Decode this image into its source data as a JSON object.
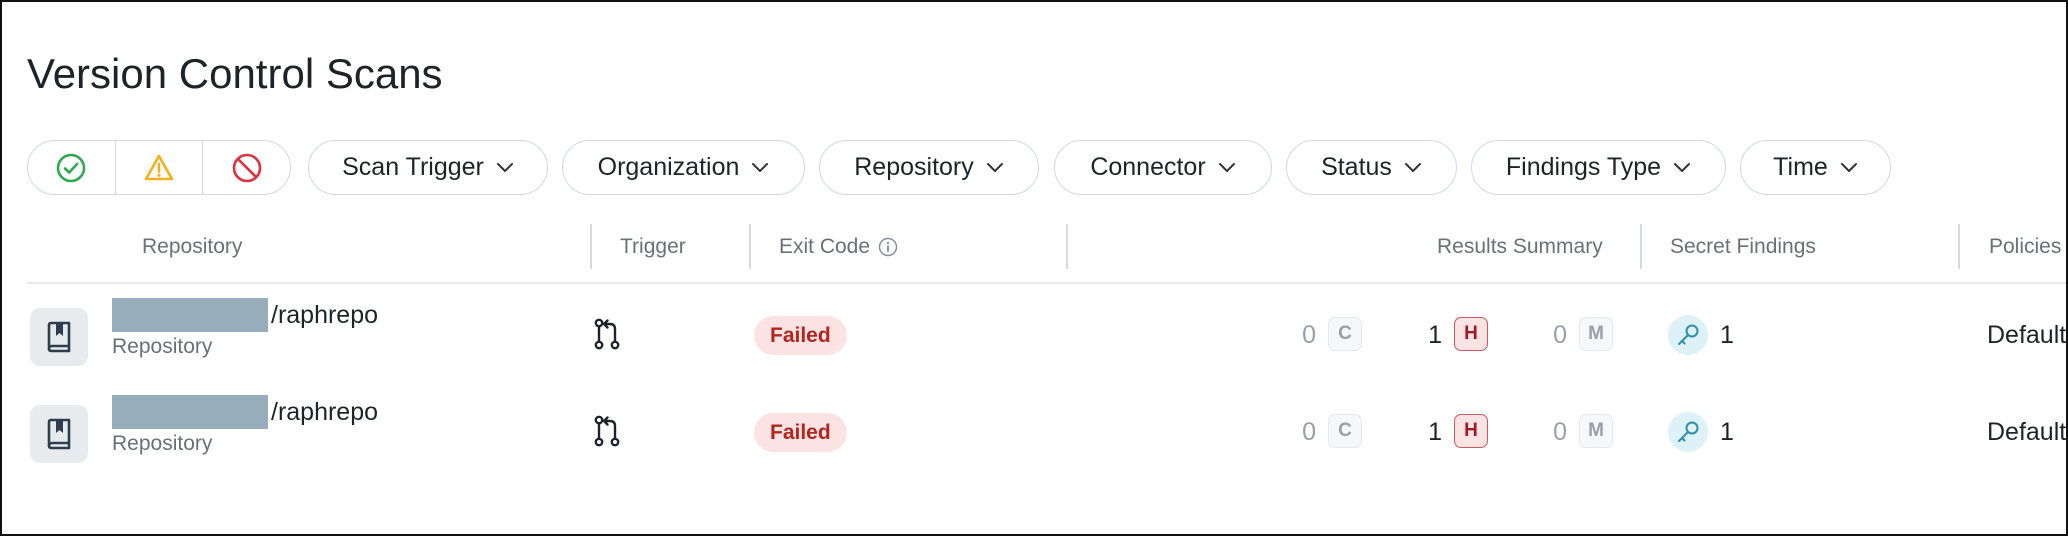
{
  "page": {
    "title": "Version Control Scans"
  },
  "status_filter": {
    "buttons": [
      {
        "name": "passed",
        "icon": "check-circle-icon",
        "color": "#2fa84f"
      },
      {
        "name": "warning",
        "icon": "warning-triangle-icon",
        "color": "#f2b01e"
      },
      {
        "name": "failed",
        "icon": "prohibited-icon",
        "color": "#d9333f"
      }
    ]
  },
  "filters": {
    "scan_trigger": "Scan Trigger",
    "organization": "Organization",
    "repository": "Repository",
    "connector": "Connector",
    "status": "Status",
    "findings_type": "Findings Type",
    "time": "Time",
    "dropdown_icon": "chevron-down-icon"
  },
  "table": {
    "headers": {
      "repository": "Repository",
      "trigger": "Trigger",
      "exit_code": "Exit Code",
      "results_summary": "Results Summary",
      "secret_findings": "Secret Findings",
      "policies": "Policies"
    },
    "rows": [
      {
        "repo_name": "/raphrepo",
        "repo_type": "Repository",
        "trigger_icon": "pull-request-icon",
        "exit_code": "Failed",
        "critical": "0",
        "critical_label": "C",
        "high": "1",
        "high_label": "H",
        "medium": "0",
        "medium_label": "M",
        "secret_count": "1",
        "policy": "Default"
      },
      {
        "repo_name": "/raphrepo",
        "repo_type": "Repository",
        "trigger_icon": "pull-request-icon",
        "exit_code": "Failed",
        "critical": "0",
        "critical_label": "C",
        "high": "1",
        "high_label": "H",
        "medium": "0",
        "medium_label": "M",
        "secret_count": "1",
        "policy": "Default"
      }
    ]
  },
  "colors": {
    "failed_badge_bg": "#fbe3e4",
    "failed_badge_text": "#b3261e",
    "high_severity": "#9b1c24",
    "secret_icon_bg": "#dcf2f6",
    "redacted_owner": "#97adbc"
  }
}
